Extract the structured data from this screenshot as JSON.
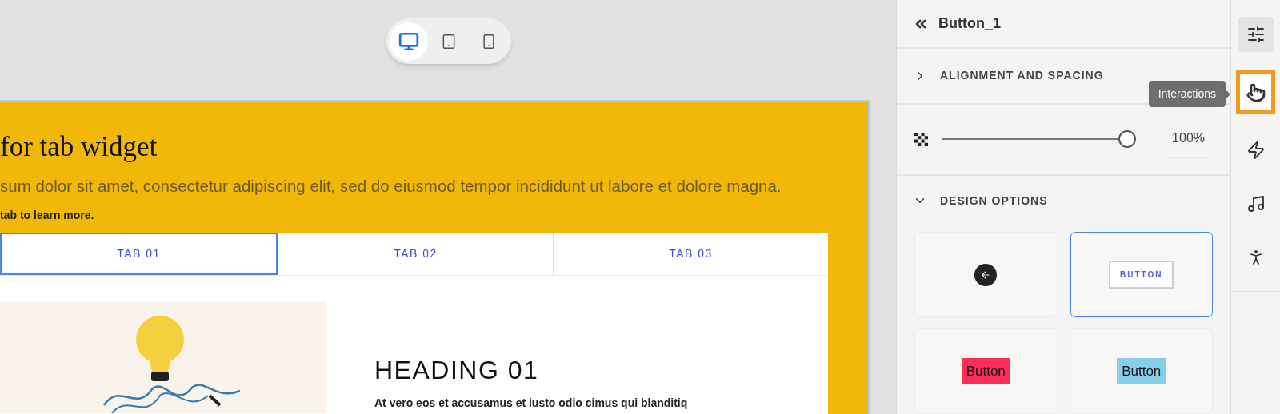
{
  "device_toggle": [
    {
      "kind": "desktop",
      "selected": true
    },
    {
      "kind": "tablet",
      "selected": false
    },
    {
      "kind": "phone",
      "selected": false
    }
  ],
  "canvas": {
    "title": "for tab widget",
    "paragraph": "sum dolor sit amet, consectetur adipiscing elit, sed do eiusmod tempor incididunt ut labore et dolore magna.",
    "hint": "tab to learn more.",
    "tabs": [
      {
        "label": "TAB 01",
        "selected": true
      },
      {
        "label": "TAB 02",
        "selected": false
      },
      {
        "label": "TAB 03",
        "selected": false
      }
    ],
    "panel": {
      "heading": "HEADING 01",
      "body": "At vero eos et accusamus et iusto odio cimus qui blanditiq"
    }
  },
  "properties": {
    "title": "Button_1",
    "sections": [
      {
        "label": "ALIGNMENT AND SPACING",
        "expanded": false
      }
    ],
    "opacity": {
      "level": 1,
      "reading": "100%"
    },
    "design_options": {
      "label": "DESIGN OPTIONS",
      "expanded": true,
      "cards": [
        {
          "kind": "round-icon",
          "selected": false
        },
        {
          "kind": "outlined",
          "label": "BUTTON",
          "selected": true
        },
        {
          "kind": "filled",
          "label": "Button",
          "color": "#fe2d5a",
          "selected": false
        },
        {
          "kind": "filled",
          "label": "Button",
          "color": "#87ceeb",
          "selected": false
        }
      ]
    }
  },
  "rail": {
    "tooltip": "Interactions",
    "items": [
      {
        "kind": "settings",
        "selected": true,
        "focused": false
      },
      {
        "kind": "interactions",
        "selected": false,
        "focused": true
      },
      {
        "kind": "effects",
        "selected": false,
        "focused": false
      },
      {
        "kind": "audio",
        "selected": false,
        "focused": false
      },
      {
        "kind": "accessibility",
        "selected": false,
        "focused": false
      }
    ]
  }
}
